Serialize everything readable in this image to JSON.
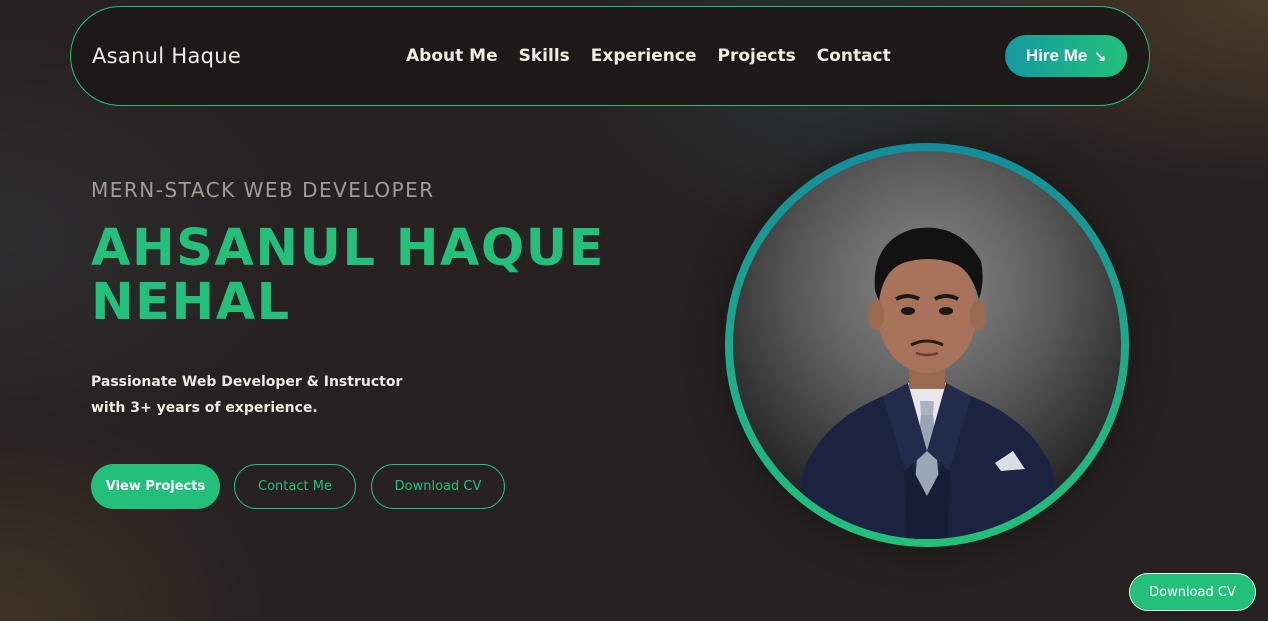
{
  "nav": {
    "brand": "Asanul Haque",
    "links": [
      "About Me",
      "Skills",
      "Experience",
      "Projects",
      "Contact"
    ],
    "hire_label": "Hire Me",
    "hire_icon": "arrow-down-right-icon"
  },
  "hero": {
    "role": "MERN-STACK WEB DEVELOPER",
    "name_line1": "AHSANUL HAQUE",
    "name_line2": "NEHAL",
    "tagline_line1": "Passionate Web Developer & Instructor",
    "tagline_line2": "with 3+ years of experience.",
    "buttons": {
      "view_projects": "View Projects",
      "contact_me": "Contact Me",
      "download_cv": "Download CV"
    }
  },
  "floating": {
    "download_cv": "Download CV"
  },
  "colors": {
    "accent": "#22c07a",
    "teal": "#149aa0",
    "background": "#272121"
  }
}
